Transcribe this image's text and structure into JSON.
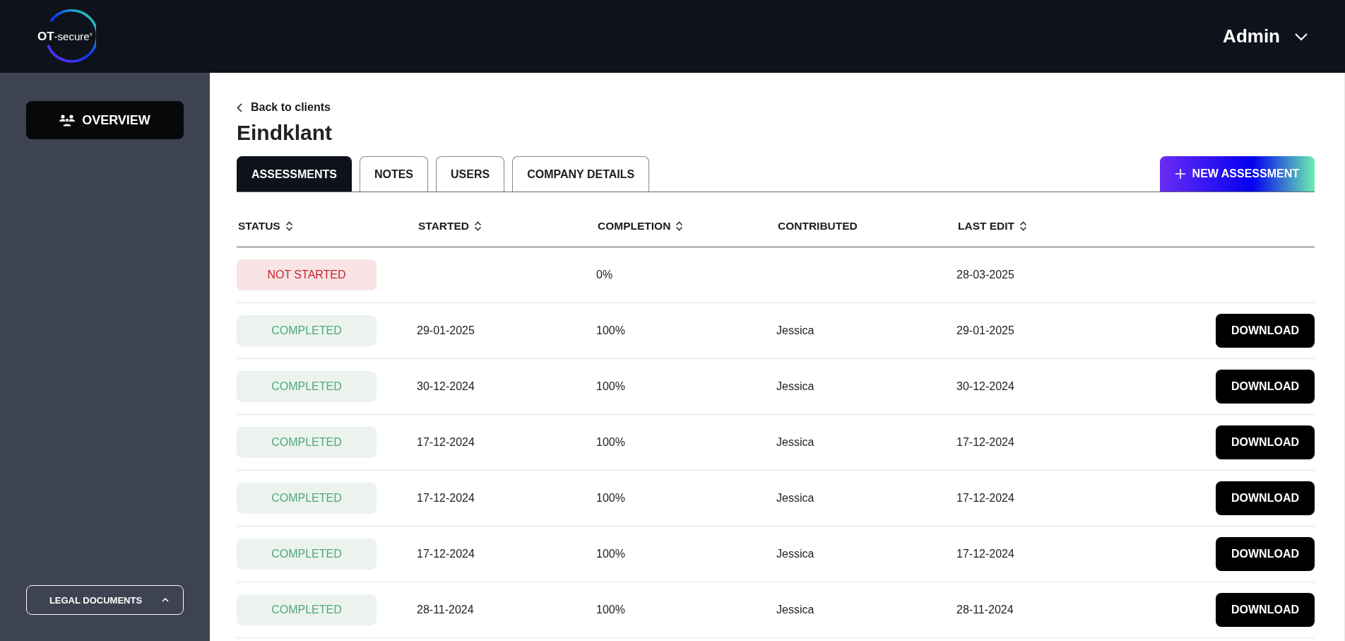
{
  "header": {
    "logo": {
      "text": "OT",
      "suffix": "-secure",
      "mark": "®"
    },
    "user": "Admin"
  },
  "sidebar": {
    "items": [
      {
        "label": "OVERVIEW",
        "selected": true
      }
    ],
    "footer": {
      "label": "LEGAL DOCUMENTS",
      "expanded": true
    }
  },
  "back_link": "Back to clients",
  "title": "Eindklant",
  "tabs": [
    {
      "label": "ASSESSMENTS",
      "selected": true
    },
    {
      "label": "NOTES",
      "selected": false
    },
    {
      "label": "USERS",
      "selected": false
    },
    {
      "label": "COMPANY DETAILS",
      "selected": false
    }
  ],
  "new_button": "NEW ASSESSMENT",
  "table": {
    "columns": [
      {
        "label": "STATUS",
        "sortable": true
      },
      {
        "label": "STARTED",
        "sortable": true
      },
      {
        "label": "COMPLETION",
        "sortable": true
      },
      {
        "label": "CONTRIBUTED",
        "sortable": false
      },
      {
        "label": "LAST EDIT",
        "sortable": true
      }
    ],
    "rows": [
      {
        "status": {
          "label": "NOT STARTED",
          "kind": "not_started"
        },
        "started": "",
        "completion": "0%",
        "contributed": "",
        "last_edit": "28-03-2025"
      },
      {
        "status": {
          "label": "COMPLETED",
          "kind": "completed"
        },
        "started": "29-01-2025",
        "completion": "100%",
        "contributed": "Jessica",
        "last_edit": "29-01-2025",
        "action": "DOWNLOAD"
      },
      {
        "status": {
          "label": "COMPLETED",
          "kind": "completed"
        },
        "started": "30-12-2024",
        "completion": "100%",
        "contributed": "Jessica",
        "last_edit": "30-12-2024",
        "action": "DOWNLOAD"
      },
      {
        "status": {
          "label": "COMPLETED",
          "kind": "completed"
        },
        "started": "17-12-2024",
        "completion": "100%",
        "contributed": "Jessica",
        "last_edit": "17-12-2024",
        "action": "DOWNLOAD"
      },
      {
        "status": {
          "label": "COMPLETED",
          "kind": "completed"
        },
        "started": "17-12-2024",
        "completion": "100%",
        "contributed": "Jessica",
        "last_edit": "17-12-2024",
        "action": "DOWNLOAD"
      },
      {
        "status": {
          "label": "COMPLETED",
          "kind": "completed"
        },
        "started": "17-12-2024",
        "completion": "100%",
        "contributed": "Jessica",
        "last_edit": "17-12-2024",
        "action": "DOWNLOAD"
      },
      {
        "status": {
          "label": "COMPLETED",
          "kind": "completed"
        },
        "started": "28-11-2024",
        "completion": "100%",
        "contributed": "Jessica",
        "last_edit": "28-11-2024",
        "action": "DOWNLOAD"
      }
    ]
  }
}
